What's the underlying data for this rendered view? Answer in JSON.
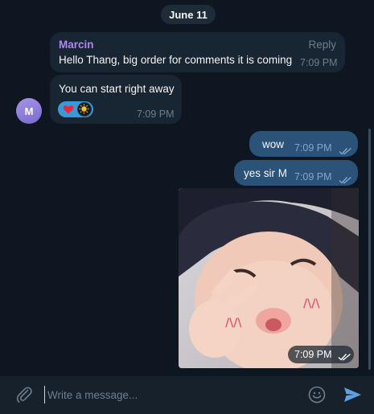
{
  "date_label": "June 11",
  "messages": {
    "m1": {
      "sender": "Marcin",
      "reply_label": "Reply",
      "text": "Hello Thang, big order for comments it is coming",
      "time": "7:09 PM"
    },
    "m2": {
      "text": "You can start right away",
      "time": "7:09 PM",
      "reactions": [
        "heart",
        "sticker-avatar"
      ]
    },
    "m3": {
      "text": "wow",
      "time": "7:09 PM",
      "status": "read"
    },
    "m4": {
      "text": "yes sir M",
      "time": "7:09 PM",
      "status": "read"
    },
    "m5": {
      "type": "photo",
      "time": "7:09 PM",
      "status": "read"
    }
  },
  "avatar": {
    "initial": "M",
    "color": "#8f7fe0"
  },
  "composer": {
    "placeholder": "Write a message..."
  },
  "colors": {
    "background": "#0e1621",
    "incoming": "#182533",
    "outgoing": "#2b5278",
    "accent": "#5ea0e0",
    "sender_name": "#b086f0"
  }
}
